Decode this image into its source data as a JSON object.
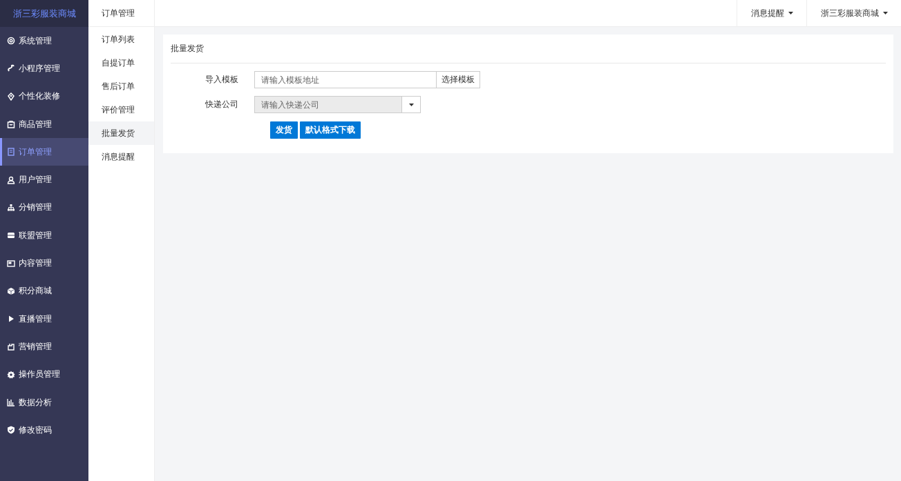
{
  "sidebar": {
    "logo": "浙三彩服装商城",
    "items": [
      {
        "label": "系统管理",
        "selected": false
      },
      {
        "label": "小程序管理",
        "selected": false
      },
      {
        "label": "个性化装修",
        "selected": false
      },
      {
        "label": "商品管理",
        "selected": false
      },
      {
        "label": "订单管理",
        "selected": true
      },
      {
        "label": "用户管理",
        "selected": false
      },
      {
        "label": "分销管理",
        "selected": false
      },
      {
        "label": "联盟管理",
        "selected": false
      },
      {
        "label": "内容管理",
        "selected": false
      },
      {
        "label": "积分商城",
        "selected": false
      },
      {
        "label": "直播管理",
        "selected": false
      },
      {
        "label": "营销管理",
        "selected": false
      },
      {
        "label": "操作员管理",
        "selected": false
      },
      {
        "label": "数据分析",
        "selected": false
      },
      {
        "label": "修改密码",
        "selected": false
      }
    ]
  },
  "subnav": {
    "title": "订单管理",
    "items": [
      {
        "label": "订单列表",
        "selected": false
      },
      {
        "label": "自提订单",
        "selected": false
      },
      {
        "label": "售后订单",
        "selected": false
      },
      {
        "label": "评价管理",
        "selected": false
      },
      {
        "label": "批量发货",
        "selected": true
      },
      {
        "label": "消息提醒",
        "selected": false
      }
    ]
  },
  "topbar": {
    "menus": [
      "消息提醒",
      "浙三彩服装商城"
    ]
  },
  "card": {
    "title": "批量发货",
    "template_field": {
      "label": "导入模板",
      "placeholder": "请输入模板地址",
      "button": "选择模板"
    },
    "express_field": {
      "label": "快递公司",
      "placeholder": "请输入快递公司",
      "disabled": true
    },
    "buttons": [
      "发货",
      "默认格式下载"
    ]
  }
}
